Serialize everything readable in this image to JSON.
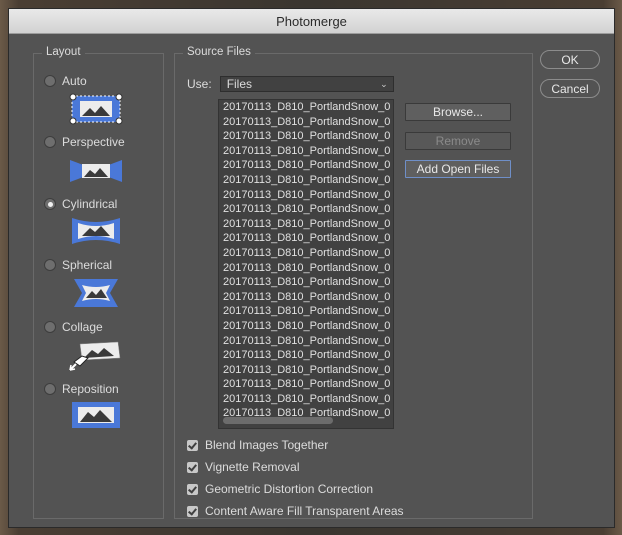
{
  "window": {
    "title": "Photomerge"
  },
  "layout": {
    "legend": "Layout",
    "options": [
      {
        "label": "Auto",
        "checked": false,
        "icon": "auto-layout-icon"
      },
      {
        "label": "Perspective",
        "checked": false,
        "icon": "perspective-layout-icon"
      },
      {
        "label": "Cylindrical",
        "checked": true,
        "icon": "cylindrical-layout-icon"
      },
      {
        "label": "Spherical",
        "checked": false,
        "icon": "spherical-layout-icon"
      },
      {
        "label": "Collage",
        "checked": false,
        "icon": "collage-layout-icon"
      },
      {
        "label": "Reposition",
        "checked": false,
        "icon": "reposition-layout-icon"
      }
    ]
  },
  "source": {
    "legend": "Source Files",
    "use_label": "Use:",
    "use_value": "Files",
    "files": [
      "20170113_D810_PortlandSnow_0",
      "20170113_D810_PortlandSnow_0",
      "20170113_D810_PortlandSnow_0",
      "20170113_D810_PortlandSnow_0",
      "20170113_D810_PortlandSnow_0",
      "20170113_D810_PortlandSnow_0",
      "20170113_D810_PortlandSnow_0",
      "20170113_D810_PortlandSnow_0",
      "20170113_D810_PortlandSnow_0",
      "20170113_D810_PortlandSnow_0",
      "20170113_D810_PortlandSnow_0",
      "20170113_D810_PortlandSnow_0",
      "20170113_D810_PortlandSnow_0",
      "20170113_D810_PortlandSnow_0",
      "20170113_D810_PortlandSnow_0",
      "20170113_D810_PortlandSnow_0",
      "20170113_D810_PortlandSnow_0",
      "20170113_D810_PortlandSnow_0",
      "20170113_D810_PortlandSnow_0",
      "20170113_D810_PortlandSnow_0",
      "20170113_D810_PortlandSnow_0",
      "20170113_D810_PortlandSnow_0"
    ],
    "browse_label": "Browse...",
    "remove_label": "Remove",
    "add_open_label": "Add Open Files"
  },
  "options": [
    {
      "label": "Blend Images Together",
      "checked": true
    },
    {
      "label": "Vignette Removal",
      "checked": true
    },
    {
      "label": "Geometric Distortion Correction",
      "checked": true
    },
    {
      "label": "Content Aware Fill Transparent Areas",
      "checked": true
    }
  ],
  "buttons": {
    "ok": "OK",
    "cancel": "Cancel"
  },
  "colors": {
    "accent": "#4a78d8",
    "dialog": "#535353"
  }
}
